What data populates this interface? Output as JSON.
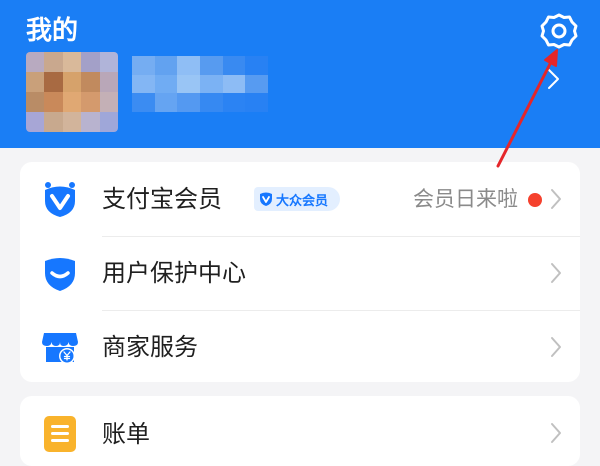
{
  "header": {
    "title": "我的",
    "background_color": "#1a7ef5",
    "settings_icon": "gear-icon",
    "profile_chevron_icon": "chevron-right-icon"
  },
  "menu_card": {
    "items": [
      {
        "label": "支付宝会员",
        "icon": "vip-v-icon",
        "badge": "大众会员",
        "trailing_text": "会员日来啦",
        "has_red_dot": true
      },
      {
        "label": "用户保护中心",
        "icon": "shield-icon"
      },
      {
        "label": "商家服务",
        "icon": "store-icon"
      }
    ]
  },
  "second_card": {
    "items": [
      {
        "label": "账单",
        "icon": "bill-icon"
      }
    ]
  },
  "colors": {
    "accent": "#1677ff",
    "annotation_arrow": "#e5262a",
    "red_dot": "#f5412d",
    "bill_icon": "#f9b32c"
  }
}
